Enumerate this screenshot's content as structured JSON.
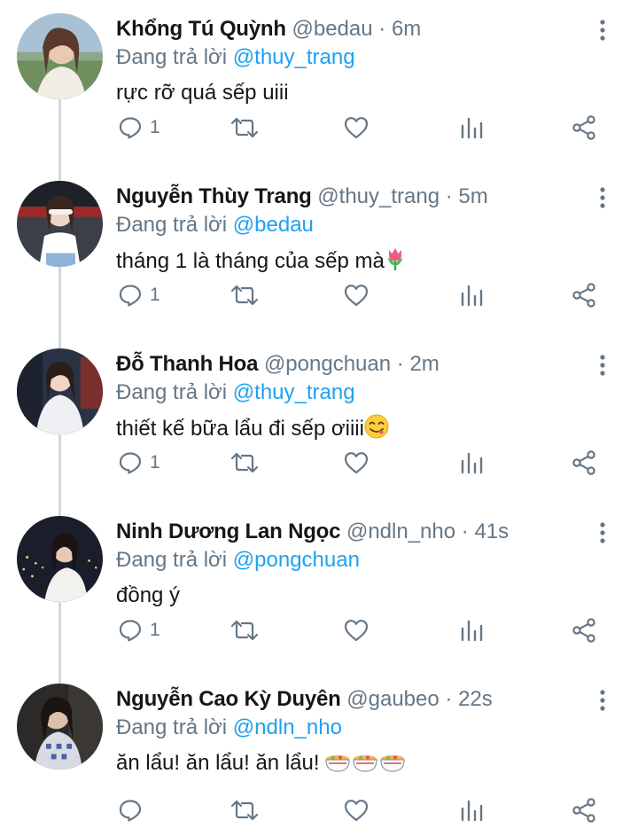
{
  "reply_prefix": "Đang trả lời",
  "tweets": [
    {
      "name": "Khổng Tú Quỳnh",
      "handle": "@bedau",
      "dot": "·",
      "time": "6m",
      "reply_to": "@thuy_trang",
      "text": "rực rỡ quá sếp uiii",
      "emoji": "",
      "reply_count": "1"
    },
    {
      "name": "Nguyễn Thùy Trang",
      "handle": "@thuy_trang",
      "dot": "·",
      "time": "5m",
      "reply_to": "@bedau",
      "text": "tháng 1 là tháng của sếp mà",
      "emoji": "tulip",
      "reply_count": "1"
    },
    {
      "name": "Đỗ Thanh Hoa",
      "handle": "@pongchuan",
      "dot": "·",
      "time": "2m",
      "reply_to": "@thuy_trang",
      "text": "thiết kế bữa lẩu đi sếp ơiiii",
      "emoji": "yum-face",
      "reply_count": "1"
    },
    {
      "name": "Ninh Dương Lan Ngọc",
      "handle": "@ndln_nho",
      "dot": "·",
      "time": "41s",
      "reply_to": "@pongchuan",
      "text": "đồng ý",
      "emoji": "",
      "reply_count": "1"
    },
    {
      "name": "Nguyễn Cao Kỳ Duyên",
      "handle": "@gaubeo",
      "dot": "·",
      "time": "22s",
      "reply_to": "@ndln_nho",
      "text": "ăn lẩu! ăn lẩu! ăn lẩu!",
      "emoji": "hotpot-bowls",
      "reply_count": ""
    }
  ],
  "colors": {
    "accent": "#1da1f2",
    "secondary_text": "#657786",
    "thread_line": "#cfd9de"
  },
  "icons": [
    "reply-icon",
    "retweet-icon",
    "like-icon",
    "stats-icon",
    "share-icon",
    "more-icon"
  ]
}
